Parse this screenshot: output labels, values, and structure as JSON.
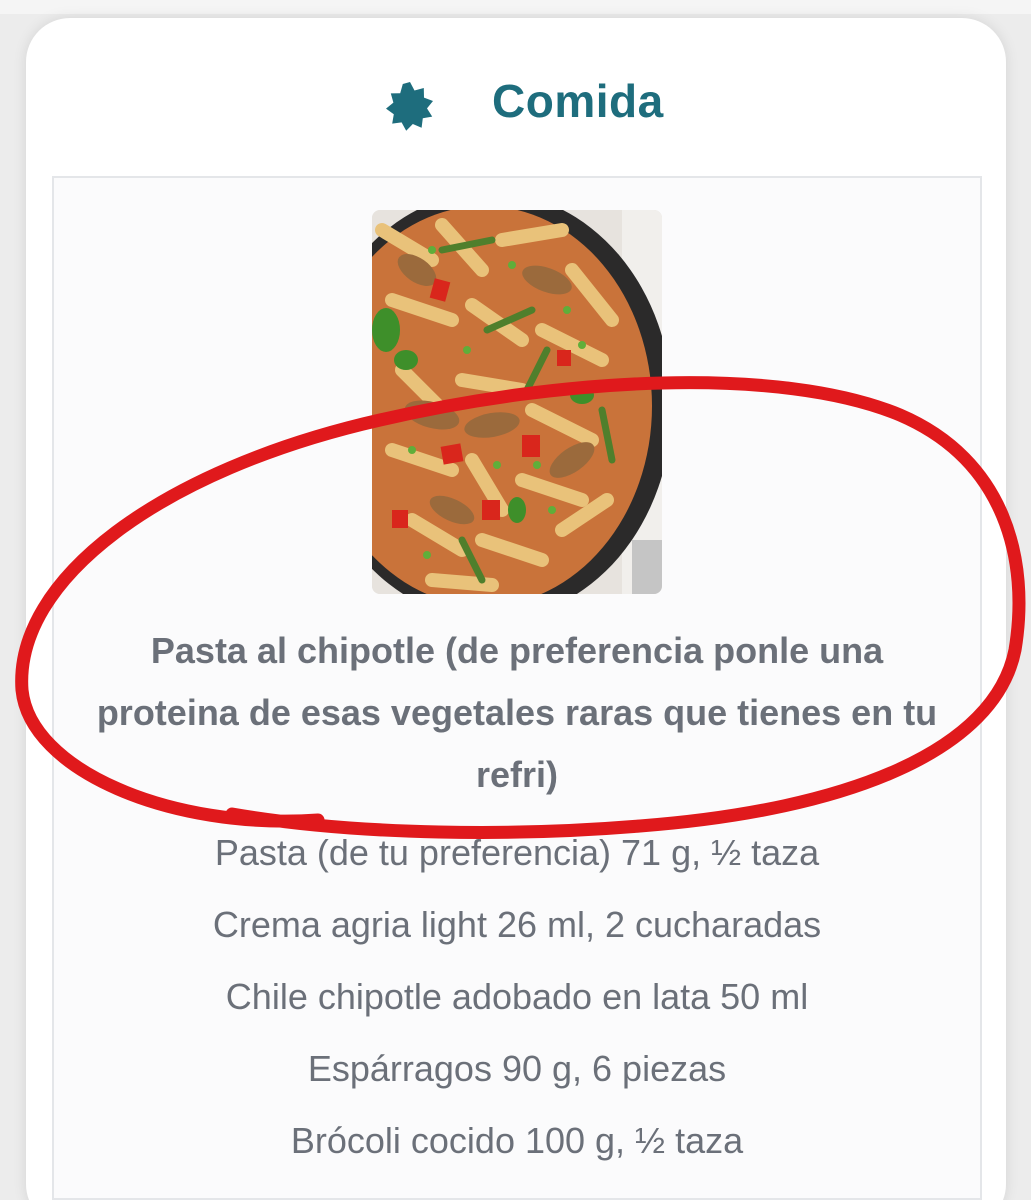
{
  "header": {
    "title": "Comida",
    "icon": "badge-star-icon",
    "accent_color": "#1e6d7d"
  },
  "meal": {
    "photo_icon": "pasta-dish-photo",
    "title": "Pasta al chipotle (de preferencia ponle una proteina de esas vegetales raras que tienes en tu refri)",
    "ingredients": [
      "Pasta (de tu preferencia) 71 g, ½ taza",
      "Crema agria light 26 ml, 2 cucharadas",
      "Chile chipotle adobado en lata 50 ml",
      "Espárragos 90 g, 6 piezas",
      "Brócoli cocido 100 g, ½ taza"
    ],
    "text_color": "#6b7079"
  },
  "annotation": {
    "shape": "hand-drawn-ellipse",
    "color": "#e0191c"
  }
}
